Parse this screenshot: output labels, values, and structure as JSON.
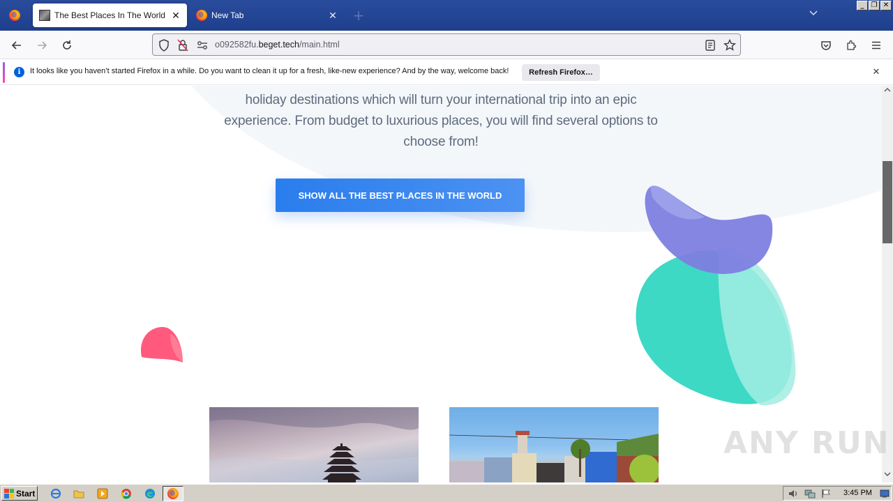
{
  "window": {
    "controls": [
      "_",
      "❐",
      "✕"
    ]
  },
  "tabs": [
    {
      "title": "The Best Places In The World",
      "active": true
    },
    {
      "title": "New Tab",
      "active": false
    }
  ],
  "toolbar": {
    "new_tab_label": "+",
    "tab_list_label": "⌄",
    "url_prefix": "o092582fu.",
    "url_domain": "beget.tech",
    "url_path": "/main.html"
  },
  "notification": {
    "info_glyph": "i",
    "message": "It looks like you haven’t started Firefox in a while. Do you want to clean it up for a fresh, like-new experience? And by the way, welcome back!",
    "button_label": "Refresh Firefox…",
    "close_label": "✕"
  },
  "page": {
    "intro_line1": "holiday destinations which will turn your international trip into an epic",
    "intro_line2": "experience. From budget to luxurious places, you will find several options to",
    "intro_line3": "choose from!",
    "cta_label": "SHOW ALL THE BEST PLACES IN THE WORLD"
  },
  "watermark": "ANY RUN",
  "taskbar": {
    "start_label": "Start",
    "clock": "3:45 PM"
  },
  "colors": {
    "cta": "#2a7ded",
    "tabstrip": "#1e3f8c",
    "blob_purple": "#7d80e0",
    "blob_teal": "#3dd9c5",
    "blob_pink": "#ff5a7e"
  }
}
